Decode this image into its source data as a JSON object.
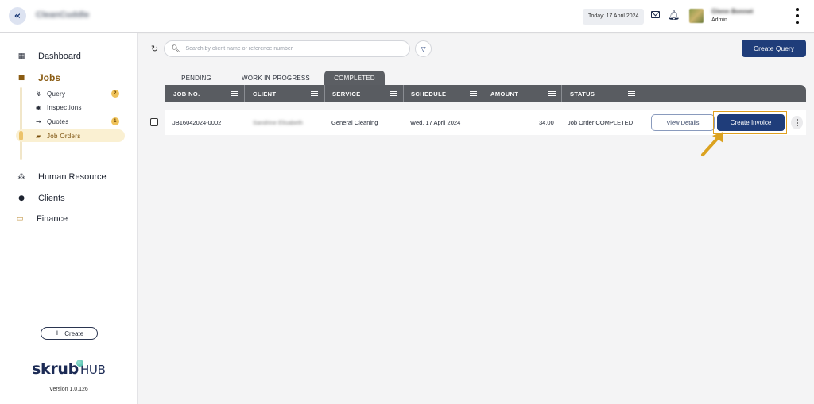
{
  "topbar": {
    "collapse_icon": "chevron-double-left-icon",
    "company_name": "CleanCuddle",
    "today": "Today: 17 April 2024",
    "user_name": "Glenn Bonnet",
    "user_role": "Admin"
  },
  "sidebar": {
    "dashboard": "Dashboard",
    "jobs": "Jobs",
    "jobs_items": [
      {
        "label": "Query",
        "badge": "2"
      },
      {
        "label": "Inspections",
        "badge": ""
      },
      {
        "label": "Quotes",
        "badge": "1"
      },
      {
        "label": "Job Orders",
        "badge": ""
      }
    ],
    "human_resource": "Human Resource",
    "clients": "Clients",
    "finance": "Finance",
    "create": "Create",
    "logo_main": "skrub",
    "logo_suffix": "HUB",
    "version": "Version 1.0.126"
  },
  "toolbar": {
    "search_placeholder": "Search by client name or reference number",
    "create_query": "Create Query"
  },
  "tabs": [
    "PENDING",
    "WORK IN PROGRESS",
    "COMPLETED"
  ],
  "table": {
    "columns": [
      "JOB NO.",
      "CLIENT",
      "SERVICE",
      "SCHEDULE",
      "AMOUNT",
      "STATUS"
    ],
    "rows": [
      {
        "job_no": "JB16042024-0002",
        "client": "Sandrine Elisabeth",
        "service": "General Cleaning",
        "schedule": "Wed, 17 April 2024",
        "amount": "34.00",
        "status": "Job Order COMPLETED",
        "view_details": "View Details",
        "create_invoice": "Create Invoice"
      }
    ]
  },
  "colors": {
    "primary": "#1f3d7a",
    "accent": "#e0a020",
    "header": "#595c61"
  }
}
